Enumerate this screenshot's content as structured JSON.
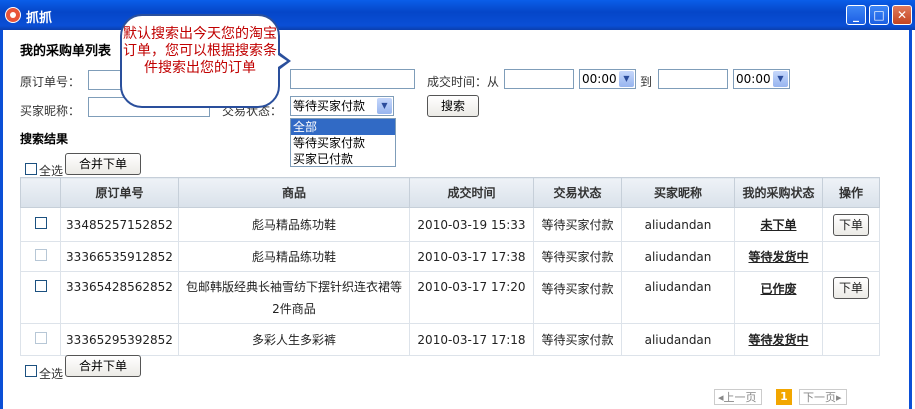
{
  "window": {
    "title": "抓抓",
    "min_label": "_",
    "max_label": "□",
    "close_label": "✕"
  },
  "page": {
    "heading": "我的采购单列表",
    "results_label": "搜索结果"
  },
  "tooltip": {
    "text": "默认搜索出今天您的淘宝订单，您可以根据搜索条件搜索出您的订单"
  },
  "search": {
    "order_no_label": "原订单号：",
    "buyer_label": "买家昵称：",
    "status_label": "交易状态：",
    "time_label": "成交时间：从",
    "to_label": "到",
    "time_from_value": "00:00",
    "time_to_value": "00:00",
    "status_value": "等待买家付款",
    "status_options": [
      "全部",
      "等待买家付款",
      "买家已付款"
    ],
    "search_button": "搜索"
  },
  "toolbar": {
    "select_all_label": "全选",
    "merge_button": "合并下单"
  },
  "table": {
    "headers": [
      "",
      "原订单号",
      "商品",
      "成交时间",
      "交易状态",
      "买家昵称",
      "我的采购状态",
      "操作"
    ],
    "rows": [
      {
        "order_no": "33485257152852",
        "product": "彪马精品练功鞋",
        "time": "2010-03-19 15:33",
        "trade_status": "等待买家付款",
        "buyer": "aliudandan",
        "purchase_status": "未下单",
        "action": "下单"
      },
      {
        "order_no": "33366535912852",
        "product": "彪马精品练功鞋",
        "time": "2010-03-17 17:38",
        "trade_status": "等待买家付款",
        "buyer": "aliudandan",
        "purchase_status": "等待发货中",
        "action": ""
      },
      {
        "order_no": "33365428562852",
        "product": "包邮韩版经典长袖雪纺下摆针织连衣裙等2件商品",
        "time": "2010-03-17 17:20",
        "trade_status": "等待买家付款",
        "buyer": "aliudandan",
        "purchase_status": "已作废",
        "action": "下单"
      },
      {
        "order_no": "33365295392852",
        "product": "多彩人生多彩裤",
        "time": "2010-03-17 17:18",
        "trade_status": "等待买家付款",
        "buyer": "aliudandan",
        "purchase_status": "等待发货中",
        "action": ""
      }
    ]
  },
  "pager": {
    "prev": "上一页",
    "current": "1",
    "next": "下一页"
  }
}
